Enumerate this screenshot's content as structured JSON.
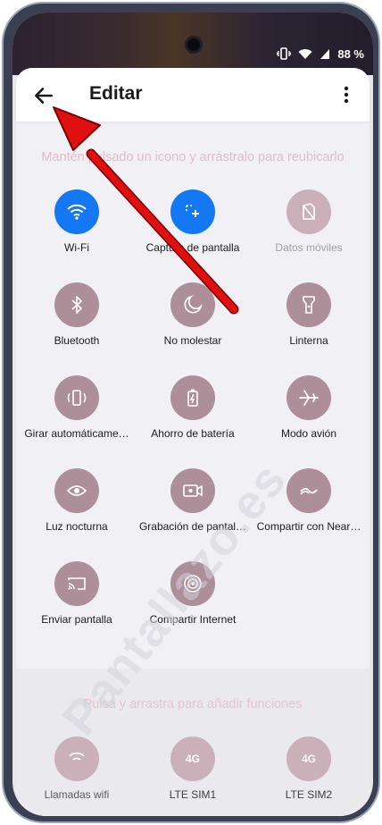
{
  "status_bar": {
    "battery": "88 %"
  },
  "app_bar": {
    "title": "Editar"
  },
  "hint_top": "Mantén pulsado un icono y arrástralo para reubicarlo",
  "hint_bottom": "Pulsa y arrastra para añadir funciones",
  "tiles": [
    {
      "label": "Wi-Fi",
      "icon": "wifi-icon",
      "active": true
    },
    {
      "label": "Captura de pantalla",
      "icon": "screenshot-icon",
      "active": true
    },
    {
      "label": "Datos móviles",
      "icon": "mobile-data-icon",
      "active": false,
      "dim": true
    },
    {
      "label": "Bluetooth",
      "icon": "bluetooth-icon",
      "active": false
    },
    {
      "label": "No molestar",
      "icon": "moon-icon",
      "active": false
    },
    {
      "label": "Linterna",
      "icon": "flashlight-icon",
      "active": false
    },
    {
      "label": "Girar automáticame…",
      "icon": "auto-rotate-icon",
      "active": false
    },
    {
      "label": "Ahorro de batería",
      "icon": "battery-saver-icon",
      "active": false
    },
    {
      "label": "Modo avión",
      "icon": "airplane-icon",
      "active": false
    },
    {
      "label": "Luz nocturna",
      "icon": "eye-icon",
      "active": false
    },
    {
      "label": "Grabación de pantal…",
      "icon": "screen-record-icon",
      "active": false
    },
    {
      "label": "Compartir con Near…",
      "icon": "nearby-share-icon",
      "active": false
    },
    {
      "label": "Enviar pantalla",
      "icon": "cast-icon",
      "active": false
    },
    {
      "label": "Compartir Internet",
      "icon": "hotspot-icon",
      "active": false
    }
  ],
  "available_tiles": [
    {
      "label": "Llamadas wifi",
      "icon": "wifi-calling-icon"
    },
    {
      "label": "LTE SIM1",
      "icon": "4g-icon",
      "icon_text": "4G"
    },
    {
      "label": "LTE SIM2",
      "icon": "4g-icon",
      "icon_text": "4G"
    }
  ],
  "watermark": "Pantallazo.es",
  "colors": {
    "active": "#1478f2",
    "inactive": "#ad8f9a",
    "arrow": "#e01010"
  }
}
